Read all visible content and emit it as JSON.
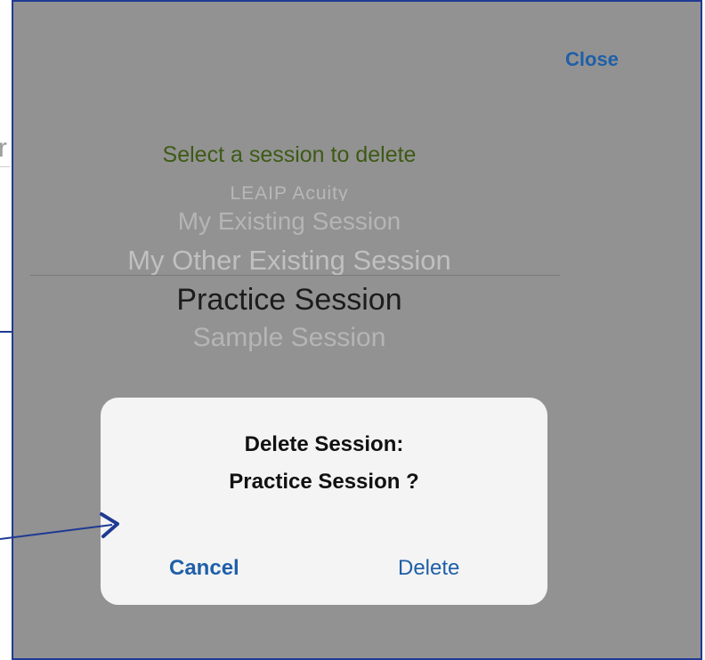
{
  "background": {
    "partial_text": "r"
  },
  "header": {
    "close_label": "Close"
  },
  "picker": {
    "title": "Select a session to delete",
    "items": [
      "LEAIP Acuity",
      "My Existing Session",
      "My Other Existing Session",
      "Practice Session",
      "Sample Session"
    ],
    "selected_index": 3
  },
  "alert": {
    "message_line1": "Delete Session:",
    "message_line2": "Practice Session ?",
    "cancel_label": "Cancel",
    "delete_label": "Delete"
  },
  "colors": {
    "accent": "#1f5fa8",
    "frame": "#1f3a93",
    "overlay": "#929292",
    "title": "#3d5a14"
  },
  "annotation": {
    "arrow_icon": "arrow-right-icon"
  }
}
